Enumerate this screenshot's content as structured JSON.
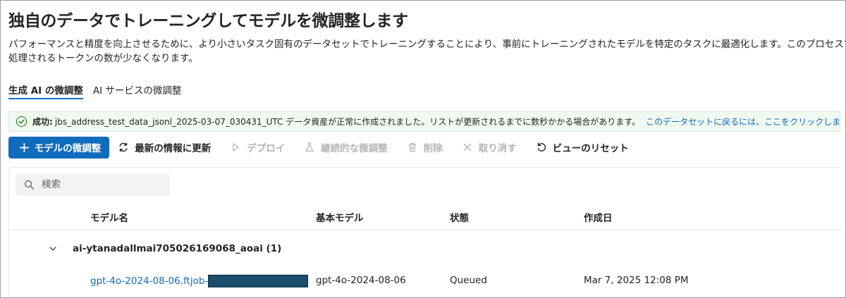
{
  "page": {
    "title": "独自のデータでトレーニングしてモデルを微調整します",
    "description_line1": "パフォーマンスと精度を向上させるために、より小さいタスク固有のデータセットでトレーニングすることにより、事前にトレーニングされたモデルを特定のタスクに最適化します。このプロセスでは、",
    "description_line2": "処理されるトークンの数が少なくなります。"
  },
  "tabs": [
    {
      "label": "生成 AI の微調整",
      "active": true
    },
    {
      "label": "AI サービスの微調整",
      "active": false
    }
  ],
  "banner": {
    "strong": "成功:",
    "message": "jbs_address_test_data_jsonl_2025-03-07_030431_UTC データ資産が正常に作成されました。リストが更新されるまでに数秒かかる場合があります。",
    "link": "このデータセットに戻るには、ここをクリックします",
    "color": "#107c10"
  },
  "toolbar": {
    "fine_tune": "モデルの微調整",
    "refresh": "最新の情報に更新",
    "deploy": "デプロイ",
    "continuous": "継続的な微調整",
    "delete": "削除",
    "cancel": "取り消す",
    "reset_view": "ビューのリセット"
  },
  "search": {
    "placeholder": "検索"
  },
  "table": {
    "columns": [
      "モデル名",
      "基本モデル",
      "状態",
      "作成日"
    ],
    "groups": [
      {
        "name": "ai-ytanadallmai705026169068_aoai (1)",
        "rows": [
          {
            "name": "gpt-4o-2024-08-06.ftjob-",
            "base_model": "gpt-4o-2024-08-06",
            "status": "Queued",
            "created": "Mar 7, 2025 12:08 PM"
          }
        ]
      }
    ]
  },
  "colors": {
    "accent": "#0f6cbd",
    "success_bg": "#f1faf1",
    "disabled": "#b4b4b4"
  }
}
